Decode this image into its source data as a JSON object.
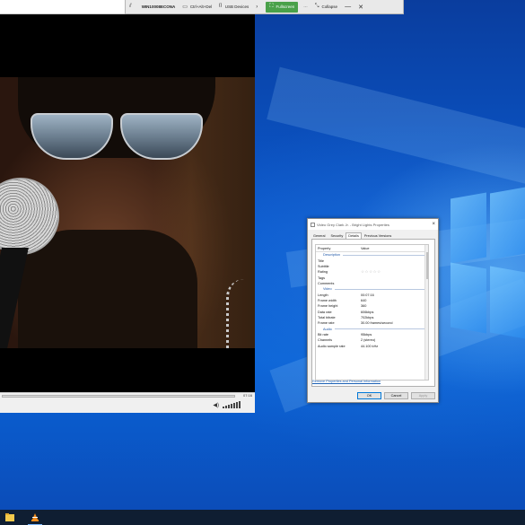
{
  "remote_bar": {
    "host": "WIN10008ECONA",
    "ctrl_alt_del": "Ctrl+Alt+Del",
    "usb_devices": "USB Devices",
    "fullscreen": "Fullscreen",
    "more": "···",
    "collapse": "Collapse"
  },
  "player": {
    "total_time": "07:16",
    "progress_fraction": 0.0
  },
  "dialog": {
    "title": "Video Grey Clark Jr. - Bright Lights Properties",
    "tabs": [
      "General",
      "Security",
      "Details",
      "Previous Versions"
    ],
    "active_tab": "Details",
    "columns": {
      "property": "Property",
      "value": "Value"
    },
    "sections": {
      "description": "Description",
      "video": "Video",
      "audio": "Audio"
    },
    "description_rows": [
      {
        "property": "Title",
        "value": ""
      },
      {
        "property": "Subtitle",
        "value": ""
      },
      {
        "property": "Rating",
        "value": "☆☆☆☆☆"
      },
      {
        "property": "Tags",
        "value": ""
      },
      {
        "property": "Comments",
        "value": ""
      }
    ],
    "video_rows": [
      {
        "property": "Length",
        "value": "00:07:16"
      },
      {
        "property": "Frame width",
        "value": "640"
      },
      {
        "property": "Frame height",
        "value": "360"
      },
      {
        "property": "Data rate",
        "value": "606kbps"
      },
      {
        "property": "Total bitrate",
        "value": "702kbps"
      },
      {
        "property": "Frame rate",
        "value": "30.00 frames/second"
      }
    ],
    "audio_rows": [
      {
        "property": "Bit rate",
        "value": "95kbps"
      },
      {
        "property": "Channels",
        "value": "2 (stereo)"
      },
      {
        "property": "Audio sample rate",
        "value": "44.100 kHz"
      }
    ],
    "remove_link": "Remove Properties and Personal Information",
    "buttons": {
      "ok": "OK",
      "cancel": "Cancel",
      "apply": "Apply"
    }
  },
  "colors": {
    "desktop_blue": "#0b5bd0",
    "fullscreen_green": "#4aa14a",
    "taskbar": "#0f1e32",
    "link_blue": "#1a5fb4"
  },
  "taskbar": {
    "icons": [
      "file-explorer-icon",
      "vlc-icon"
    ]
  }
}
